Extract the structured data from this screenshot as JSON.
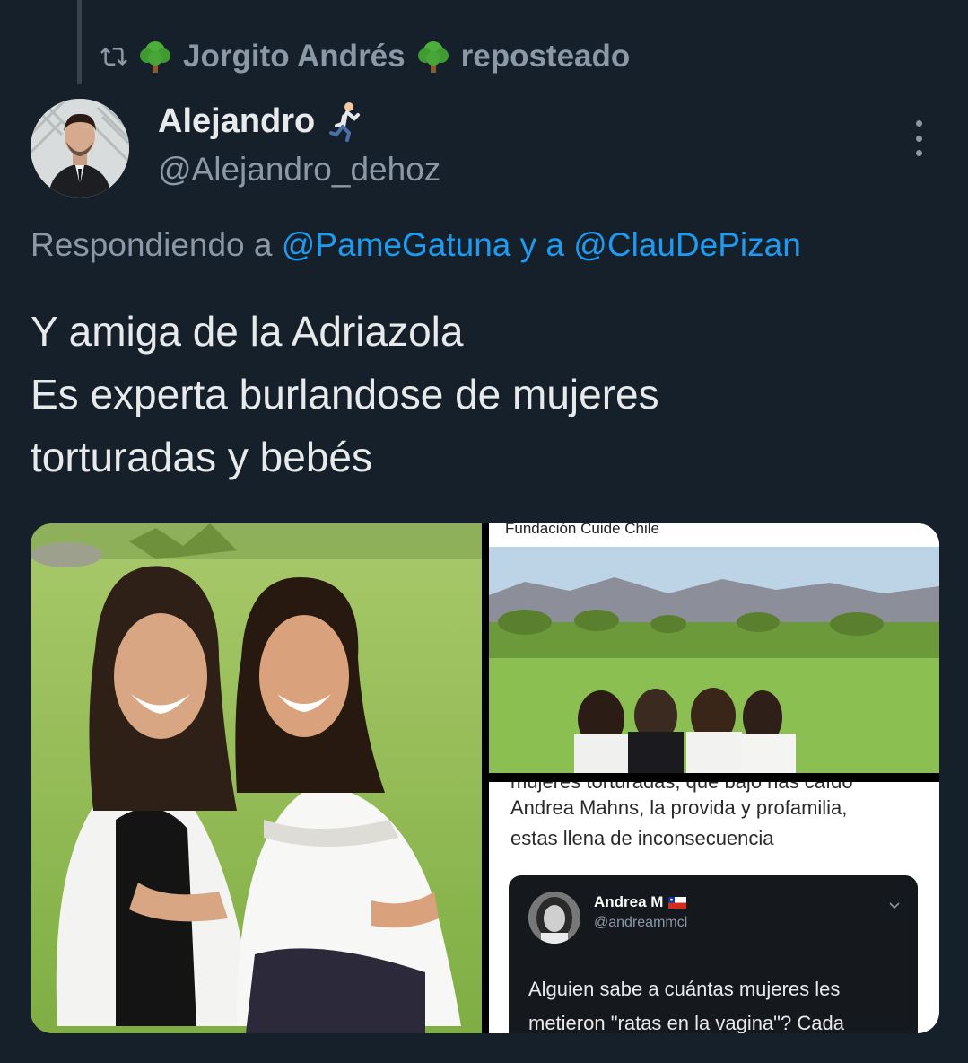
{
  "repost": {
    "reposter": "Jorgito Andrés",
    "label": "reposteado",
    "icon": "repost-icon",
    "emoji": "tree-emoji"
  },
  "author": {
    "name": "Alejandro",
    "handle": "@Alejandro_dehoz",
    "emoji": "runner-emoji"
  },
  "replying": {
    "prefix": "Respondiendo a",
    "mention1": "@PameGatuna",
    "connector": "y a",
    "mention2": "@ClauDePizan"
  },
  "tweet": {
    "lines": [
      "Y amiga de la Adriazola",
      "Es experta burlandose de mujeres",
      "torturadas y bebés"
    ]
  },
  "media": {
    "top_right_caption": "Fundación Cuide Chile",
    "bottom_right": {
      "cut_line": "mujeres torturadas, que bajo has caído",
      "lines": [
        "Andrea Mahns, la provida y profamilia,",
        "estas llena de inconsecuencia"
      ],
      "card": {
        "name": "Andrea M",
        "handle": "@andreammcl",
        "text": "Alguien sabe a cuántas mujeres les metieron \"ratas en la vagina\"? Cada"
      }
    }
  },
  "colors": {
    "background": "#15202b",
    "text": "#e7e9ea",
    "muted": "#8b98a5",
    "link": "#1d9bf0"
  }
}
